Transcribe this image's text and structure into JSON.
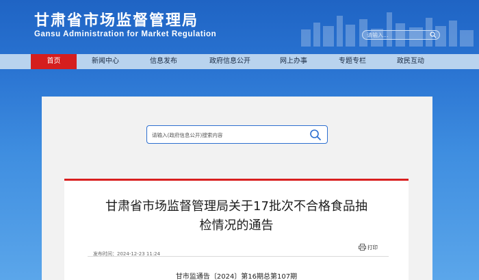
{
  "header": {
    "title": "甘肃省市场监督管理局",
    "subtitle": "Gansu Administration for Market Regulation",
    "search_placeholder": "请输入..."
  },
  "nav": {
    "items": [
      {
        "label": "首页",
        "active": true
      },
      {
        "label": "新闻中心",
        "active": false
      },
      {
        "label": "信息发布",
        "active": false
      },
      {
        "label": "政府信息公开",
        "active": false
      },
      {
        "label": "网上办事",
        "active": false
      },
      {
        "label": "专题专栏",
        "active": false
      },
      {
        "label": "政民互动",
        "active": false
      }
    ]
  },
  "search": {
    "placeholder": "请输入(政府信息公开)搜索内容"
  },
  "article": {
    "title_line1": "甘肃省市场监督管理局关于17批次不合格食品抽",
    "title_line2": "检情况的通告",
    "meta_label": "发布时间：",
    "meta_time": "2024-12-23 11:24",
    "print_label": "打印",
    "doc_number": "甘市监通告〔2024〕第16期总第107期"
  },
  "colors": {
    "brand_blue": "#1f64c4",
    "nav_bg": "#b9d3ee",
    "active_red": "#d51e1e",
    "article_accent": "#d92020"
  }
}
